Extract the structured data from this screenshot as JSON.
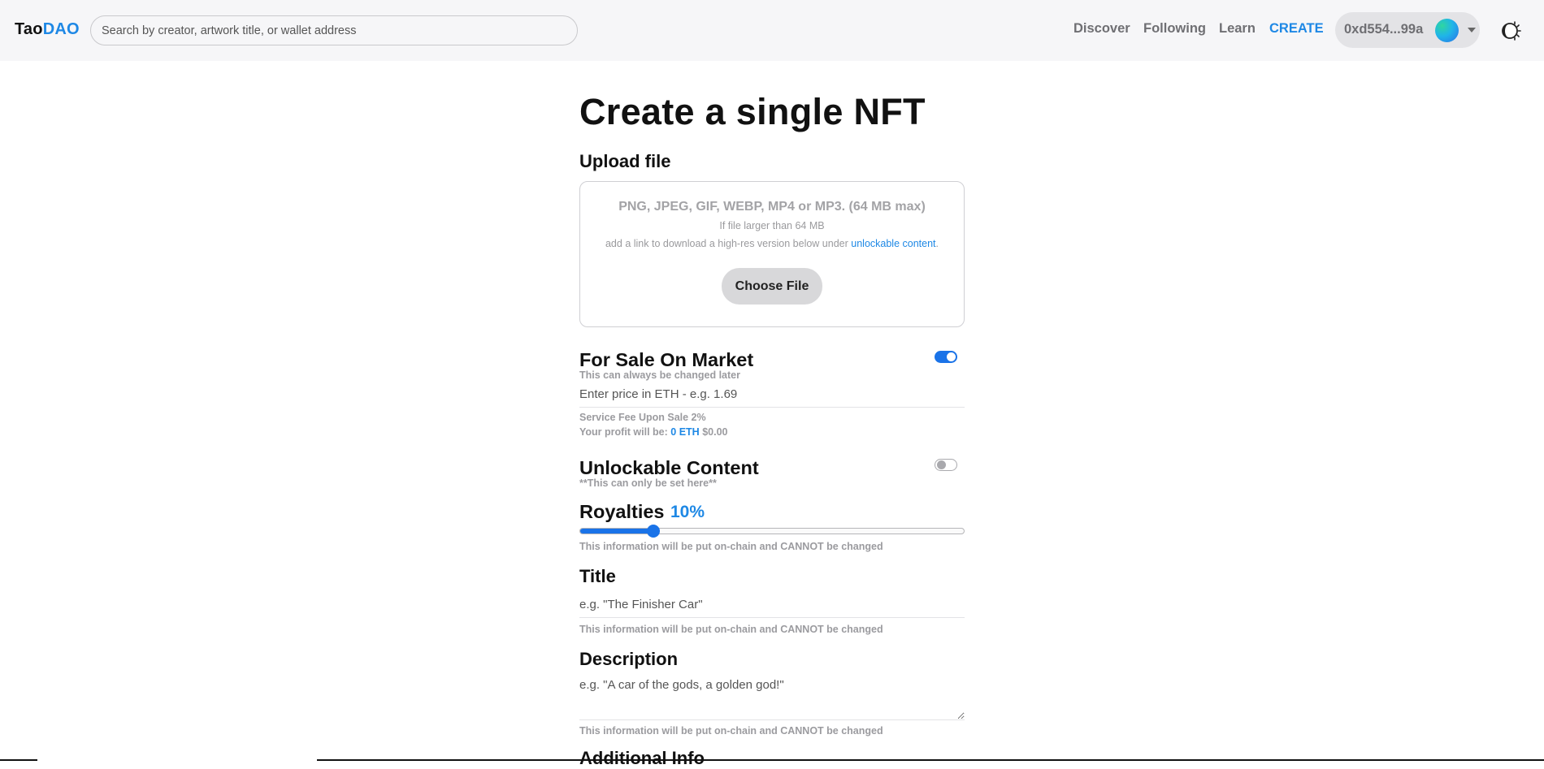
{
  "header": {
    "logo_part1": "Tao",
    "logo_part2": "DAO",
    "search_placeholder": "Search by creator, artwork title, or wallet address",
    "nav": {
      "discover": "Discover",
      "following": "Following",
      "learn": "Learn",
      "create": "CREATE"
    },
    "wallet_address": "0xd554...99a"
  },
  "page": {
    "title": "Create a single NFT",
    "upload": {
      "heading": "Upload file",
      "types": "PNG, JPEG, GIF, WEBP, MP4 or MP3. (64 MB max)",
      "note1": "If file larger than 64 MB",
      "note2_prefix": "add a link to download a high-res version below under ",
      "note2_link": "unlockable content",
      "note2_suffix": ".",
      "button": "Choose File"
    },
    "for_sale": {
      "heading": "For Sale On Market",
      "note": "This can always be changed later",
      "enabled": true,
      "price_placeholder": "Enter price in ETH - e.g. 1.69",
      "fee_text": "Service Fee Upon Sale 2%",
      "profit_label": "Your profit will be: ",
      "profit_eth": "0 ETH",
      "profit_usd": "$0.00"
    },
    "unlockable": {
      "heading": "Unlockable Content",
      "note": "**This can only be set here**",
      "enabled": false
    },
    "royalties": {
      "heading": "Royalties",
      "value_label": "10%",
      "value": 0.19,
      "note": "This information will be put on-chain and CANNOT be changed"
    },
    "title_field": {
      "heading": "Title",
      "placeholder": "e.g. \"The Finisher Car\"",
      "note": "This information will be put on-chain and CANNOT be changed"
    },
    "description_field": {
      "heading": "Description",
      "placeholder": "e.g. \"A car of the gods, a golden god!\"",
      "note": "This information will be put on-chain and CANNOT be changed"
    },
    "additional_heading": "Additional Info"
  },
  "colors": {
    "accent": "#1e88e5",
    "toggle_on": "#1a73e8",
    "header_bg": "#f6f6f8"
  }
}
